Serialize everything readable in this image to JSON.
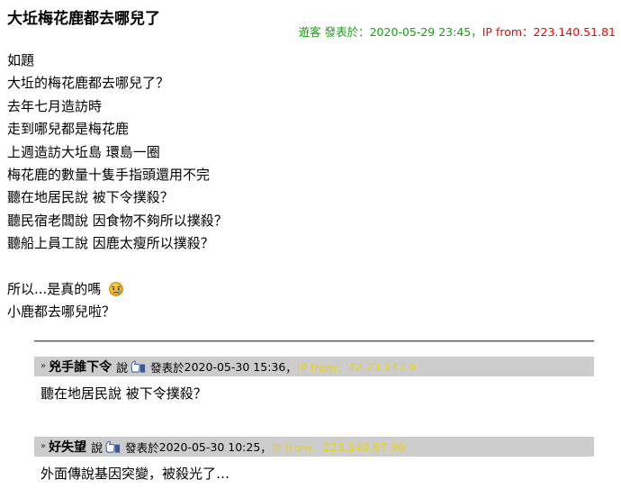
{
  "post": {
    "title": "大坵梅花鹿都去哪兒了",
    "meta": {
      "author_label": "遊客 發表於：",
      "datetime": "2020-05-29 23:45",
      "separator": "，",
      "ip_label": "IP from：",
      "ip": "223.140.51.81"
    },
    "lines": [
      "如題",
      "大坵的梅花鹿都去哪兒了？",
      "去年七月造訪時",
      "走到哪兒都是梅花鹿",
      "上週造訪大坵島 環島一圈",
      "梅花鹿的數量十隻手指頭還用不完",
      "聽在地居民說 被下令撲殺？",
      "聽民宿老闆說 因食物不夠所以撲殺？",
      "聽船上員工說 因鹿太瘦所以撲殺？"
    ],
    "closing_line": "所以...是真的嗎",
    "closing_emoji": "crying-face-emoji",
    "final_line": "小鹿都去哪兒啦？"
  },
  "comments": [
    {
      "bullet": "»",
      "author": "兇手誰下令",
      "say_label": "說",
      "icon": "thumbs-up-icon",
      "posted_label": "發表於",
      "datetime": "2020-05-30 15:36",
      "separator": "，",
      "ip_label": "IP from：",
      "ip": "42.73.147.9",
      "text": "聽在地居民說 被下令撲殺？"
    },
    {
      "bullet": "»",
      "author": "好失望",
      "say_label": "說",
      "icon": "thumbs-up-icon",
      "posted_label": "發表於",
      "datetime": "2020-05-30 10:25",
      "separator": "，",
      "ip_label": "IP from：",
      "ip": "223.140.87.96",
      "text": "外面傳說基因突變，被殺光了…"
    }
  ],
  "colors": {
    "meta_green": "#16a016",
    "meta_red": "#ff0000",
    "comment_ip_yellow": "#e8d21a",
    "comment_header_bg": "#cccccc"
  }
}
